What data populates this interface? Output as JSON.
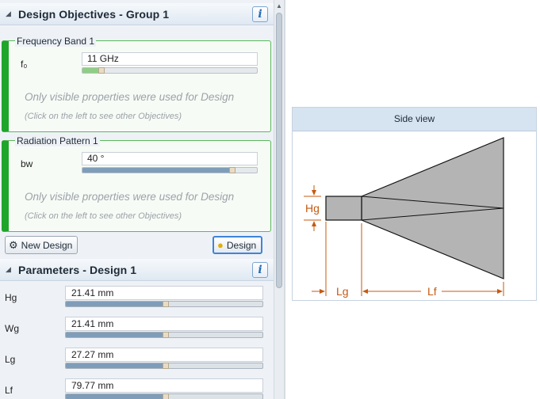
{
  "objectives_header": {
    "title": "Design Objectives  -  Group 1",
    "info_icon": "i"
  },
  "objectives": [
    {
      "legend": "Frequency Band 1",
      "property_label": "f₀",
      "value": "11 GHz",
      "slider_fraction": 0.1,
      "note": "Only visible properties were used for Design",
      "hint": "(Click on the left to see other Objectives)"
    },
    {
      "legend": "Radiation Pattern 1",
      "property_label": "bw",
      "value": "40 °",
      "slider_fraction": 0.85,
      "note": "Only visible properties were used for Design",
      "hint": "(Click on the left to see other Objectives)"
    }
  ],
  "buttons": {
    "new_design": "New Design",
    "design": "Design",
    "new_design_icon": "gears-icon",
    "design_icon": "lightbulb-icon"
  },
  "parameters_header": {
    "title": "Parameters  -  Design 1",
    "info_icon": "i"
  },
  "parameters": [
    {
      "label": "Hg",
      "value": "21.41 mm",
      "slider_fraction": 0.5
    },
    {
      "label": "Wg",
      "value": "21.41 mm",
      "slider_fraction": 0.5
    },
    {
      "label": "Lg",
      "value": "27.27 mm",
      "slider_fraction": 0.5
    },
    {
      "label": "Lf",
      "value": "79.77 mm",
      "slider_fraction": 0.5
    }
  ],
  "side_view": {
    "title": "Side view",
    "labels": {
      "hg": "Hg",
      "lg": "Lg",
      "lf": "Lf"
    }
  },
  "colors": {
    "objective_accent": "#1ea52a",
    "dimension": "#c55a11",
    "horn_fill": "#b4b4b4"
  }
}
